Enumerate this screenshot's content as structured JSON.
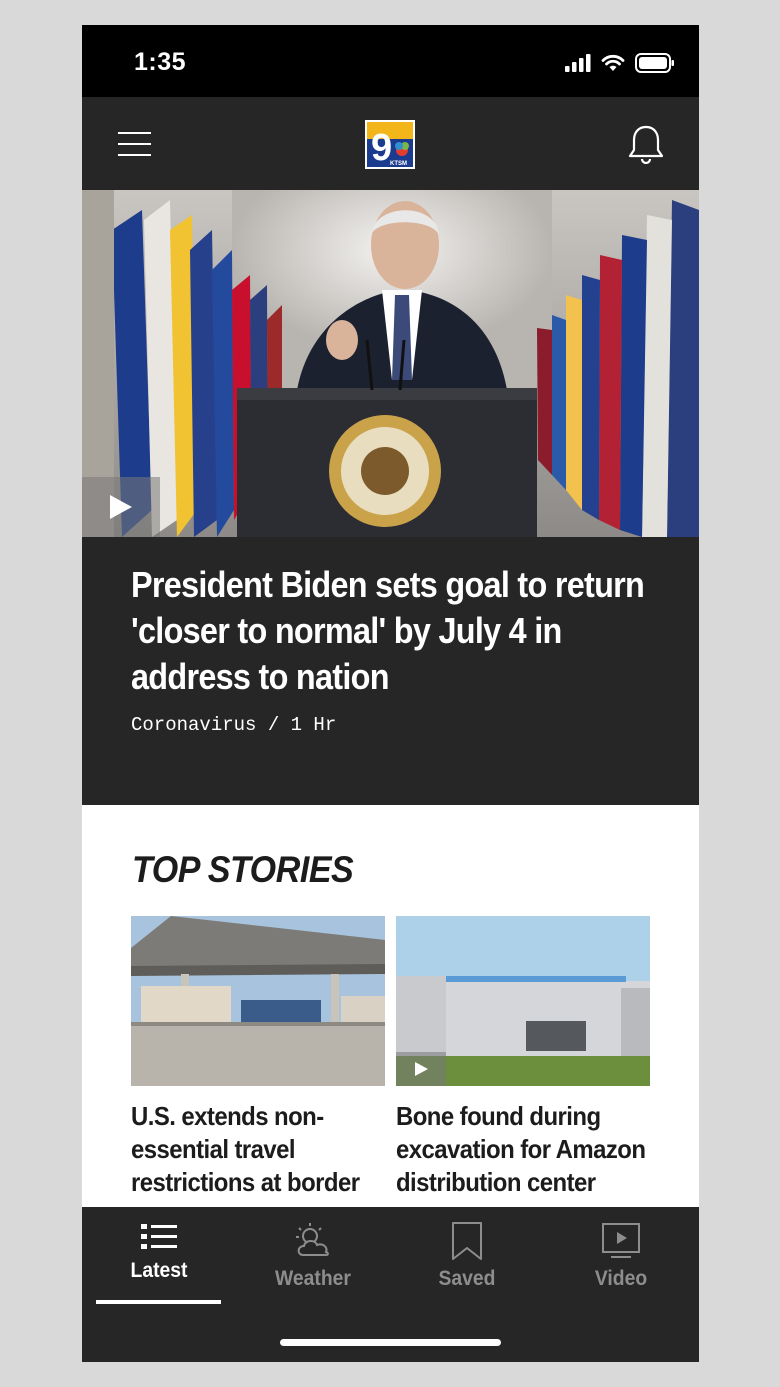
{
  "status_bar": {
    "time": "1:35"
  },
  "header": {
    "logo_number": "9",
    "logo_text": "KTSM",
    "menu_icon": "hamburger-menu-icon",
    "notification_icon": "bell-icon"
  },
  "hero": {
    "headline": "President Biden sets goal to return 'closer to normal' by July 4 in address to nation",
    "meta": "Coronavirus / 1 Hr",
    "has_video": true
  },
  "top_stories": {
    "heading": "TOP STORIES",
    "items": [
      {
        "title": "U.S. extends non-essential travel restrictions at border",
        "has_video": false
      },
      {
        "title": "Bone found during excavation for Amazon distribution center",
        "has_video": true
      }
    ]
  },
  "bottom_nav": {
    "items": [
      {
        "label": "Latest",
        "icon": "list-icon",
        "active": true
      },
      {
        "label": "Weather",
        "icon": "sun-cloud-icon",
        "active": false
      },
      {
        "label": "Saved",
        "icon": "bookmark-icon",
        "active": false
      },
      {
        "label": "Video",
        "icon": "video-play-icon",
        "active": false
      }
    ]
  },
  "colors": {
    "status_bar": "#000000",
    "header_bg": "#262626",
    "page_bg": "#ffffff",
    "nav_inactive": "#8d8d8d",
    "nav_active": "#ffffff"
  }
}
